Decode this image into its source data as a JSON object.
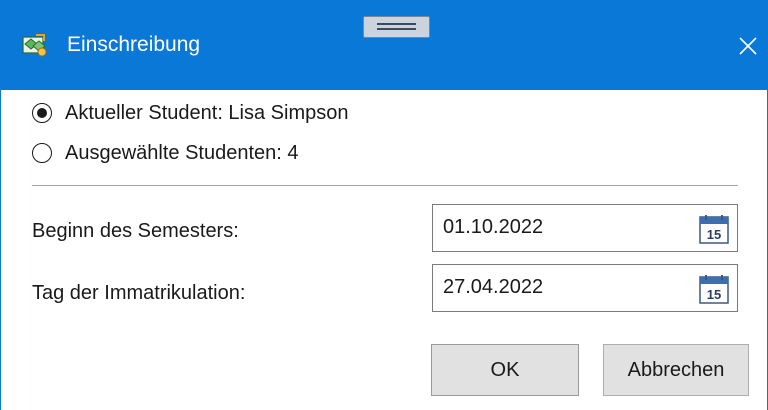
{
  "window": {
    "title": "Einschreibung",
    "app_icon": "enrollment-app-icon",
    "close_glyph": "✕"
  },
  "scope": {
    "options": [
      {
        "label": "Aktueller Student: Lisa Simpson",
        "selected": true
      },
      {
        "label": "Ausgewählte Studenten: 4",
        "selected": false
      }
    ]
  },
  "fields": {
    "semester_start": {
      "label": "Beginn des Semesters:",
      "value": "01.10.2022"
    },
    "matriculation_day": {
      "label": "Tag der Immatrikulation:",
      "value": "27.04.2022"
    }
  },
  "calendar": {
    "icon": "calendar-icon",
    "day": "15"
  },
  "buttons": {
    "ok": "OK",
    "cancel": "Abbrechen"
  },
  "colors": {
    "titlebar": "#0a78d7",
    "button_bg": "#e1e1e1",
    "field_border": "#7a7a7a"
  }
}
